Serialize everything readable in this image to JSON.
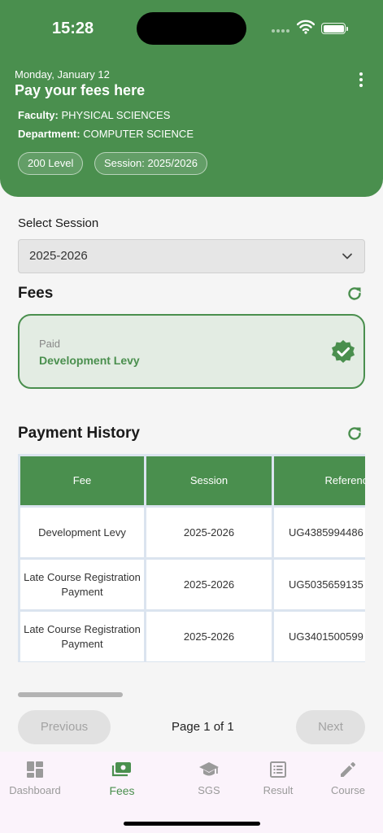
{
  "status_bar": {
    "time": "15:28"
  },
  "header": {
    "date": "Monday, January 12",
    "title": "Pay your fees here",
    "faculty_label": "Faculty:",
    "faculty_value": "PHYSICAL SCIENCES",
    "department_label": "Department:",
    "department_value": "COMPUTER SCIENCE",
    "level_badge": "200 Level",
    "session_badge": "Session: 2025/2026"
  },
  "session_select": {
    "label": "Select Session",
    "value": "2025-2026"
  },
  "fees": {
    "heading": "Fees",
    "items": [
      {
        "status": "Paid",
        "name": "Development Levy"
      }
    ]
  },
  "payment_history": {
    "heading": "Payment History",
    "columns": [
      "Fee",
      "Session",
      "Reference"
    ],
    "rows": [
      {
        "fee": "Development Levy",
        "session": "2025-2026",
        "reference": "UG4385994486"
      },
      {
        "fee": "Late Course Registration Payment",
        "session": "2025-2026",
        "reference": "UG5035659135"
      },
      {
        "fee": "Late Course Registration Payment",
        "session": "2025-2026",
        "reference": "UG3401500599"
      }
    ]
  },
  "pagination": {
    "previous_label": "Previous",
    "page_info": "Page 1 of 1",
    "next_label": "Next"
  },
  "bottom_nav": {
    "items": [
      {
        "label": "Dashboard",
        "icon": "dashboard-icon",
        "active": false
      },
      {
        "label": "Fees",
        "icon": "payments-icon",
        "active": true
      },
      {
        "label": "SGS",
        "icon": "school-icon",
        "active": false
      },
      {
        "label": "Result",
        "icon": "result-icon",
        "active": false
      },
      {
        "label": "Course",
        "icon": "edit-icon",
        "active": false
      }
    ]
  },
  "colors": {
    "primary": "#4a8f4e",
    "card_bg": "#e3ece3",
    "nav_bg": "#fbf3fb",
    "disabled_button": "#e1e1e1"
  }
}
